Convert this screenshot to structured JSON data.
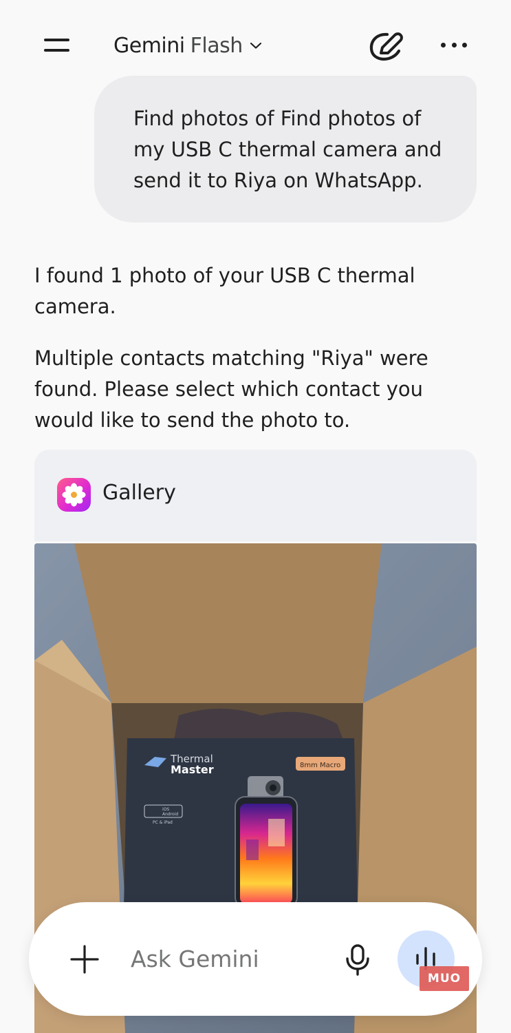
{
  "header": {
    "model_name": "Gemini",
    "model_variant": "Flash",
    "menu_icon": "hamburger-menu-icon",
    "dropdown_icon": "chevron-down-icon",
    "new_chat_icon": "new-chat-pen-icon",
    "more_icon": "more-options-icon"
  },
  "user_message": {
    "text": "Find photos of Find photos of my USB C thermal camera and send it to Riya on WhatsApp."
  },
  "response": {
    "paragraphs": [
      "I found 1 photo of your USB C thermal camera.",
      "Multiple contacts matching \"Riya\" were found. Please select which contact you would like to send the photo to."
    ]
  },
  "gallery_card": {
    "app_name": "Gallery",
    "app_icon": "gallery-flower-icon",
    "photo": {
      "box_brand_line1": "Thermal",
      "box_brand_line2": "Master",
      "box_badge": "8mm Macro",
      "box_compat_line1": "iOS",
      "box_compat_line2": "Android",
      "box_compat_line3": "PC & iPad"
    }
  },
  "input_bar": {
    "placeholder": "Ask Gemini",
    "add_icon": "plus-icon",
    "mic_icon": "microphone-icon",
    "live_icon": "gemini-live-waveform-icon"
  },
  "watermark": {
    "text": "MUO"
  },
  "colors": {
    "background": "#f9f9fa",
    "user_bubble": "#ececee",
    "card_header": "#eef0f4",
    "live_button": "#d3e3fd",
    "text": "#1f1f1f",
    "placeholder": "#747775",
    "watermark": "#df5c57"
  }
}
